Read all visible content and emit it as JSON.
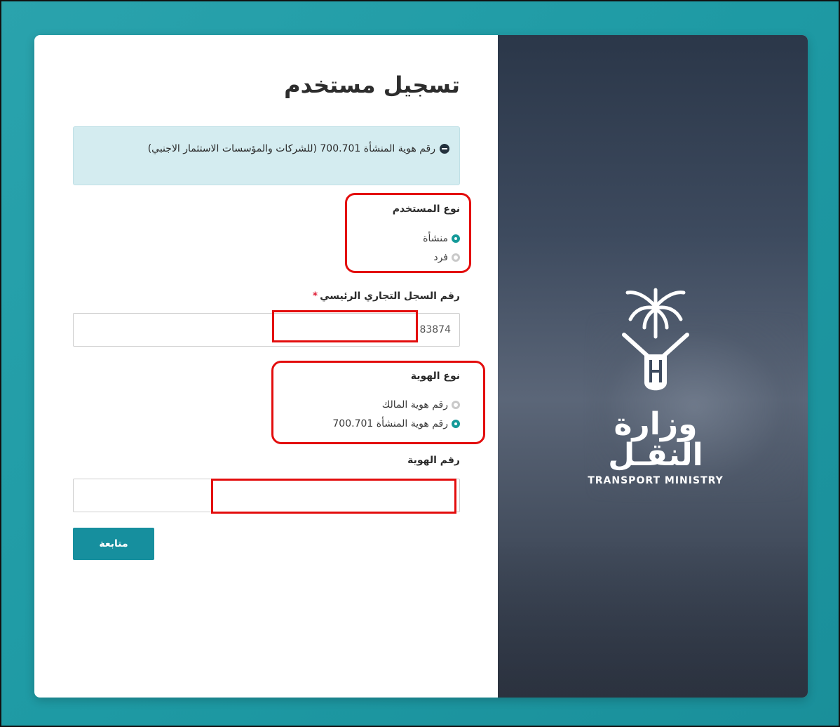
{
  "page": {
    "title": "تسجيل مستخدم",
    "info_text": "رقم هوية المنشأة 700.701 (للشركات والمؤسسات الاستثمار الاجنبي)"
  },
  "user_type": {
    "label": "نوع المستخدم",
    "options": [
      "منشأة",
      "فرد"
    ],
    "selected": "منشأة"
  },
  "cr_number": {
    "label": "رقم السجل التجاري الرئيسي",
    "required_mark": "*",
    "value": "83874"
  },
  "id_type": {
    "label": "نوع الهوية",
    "options": [
      "رقم هوية المالك",
      "رقم هوية المنشأة 700.701"
    ],
    "selected": "رقم هوية المنشأة 700.701"
  },
  "id_number": {
    "label": "رقم الهوية",
    "value": ""
  },
  "actions": {
    "continue_label": "متابعة"
  },
  "logo": {
    "arabic": "وزارة النقـل",
    "english": "TRANSPORT MINISTRY"
  },
  "colors": {
    "accent": "#168f9e",
    "radio_selected": "#159a99",
    "info_bg": "#d4ecf0",
    "highlight": "#e30d0d",
    "required": "#e0223a"
  },
  "annotations": {
    "highlight_boxes_count": 4
  }
}
